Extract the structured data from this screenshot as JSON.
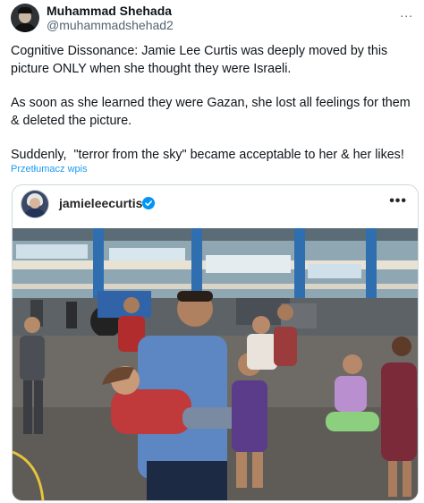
{
  "tweet": {
    "author_name": "Muhammad Shehada",
    "author_handle": "@muhammadshehad2",
    "more_label": "...",
    "paragraphs": [
      "Cognitive Dissonance: Jamie Lee Curtis was deeply moved by this picture ONLY when she thought they were Israeli.",
      "As soon as she learned they were Gazan, she lost all feelings for them & deleted the picture.",
      "Suddenly,  \"terror from the sky\" became acceptable to her & her likes!"
    ],
    "translate_label": "Przetłumacz wpis"
  },
  "embedded_post": {
    "username": "jamieleecurtis",
    "more_label": "•••",
    "verified_icon": "verified-badge-icon",
    "accent_color": "#0095f6"
  },
  "colors": {
    "text": "#0f1419",
    "secondary": "#536471",
    "link": "#1d9bf0",
    "border": "#cfd9de"
  }
}
